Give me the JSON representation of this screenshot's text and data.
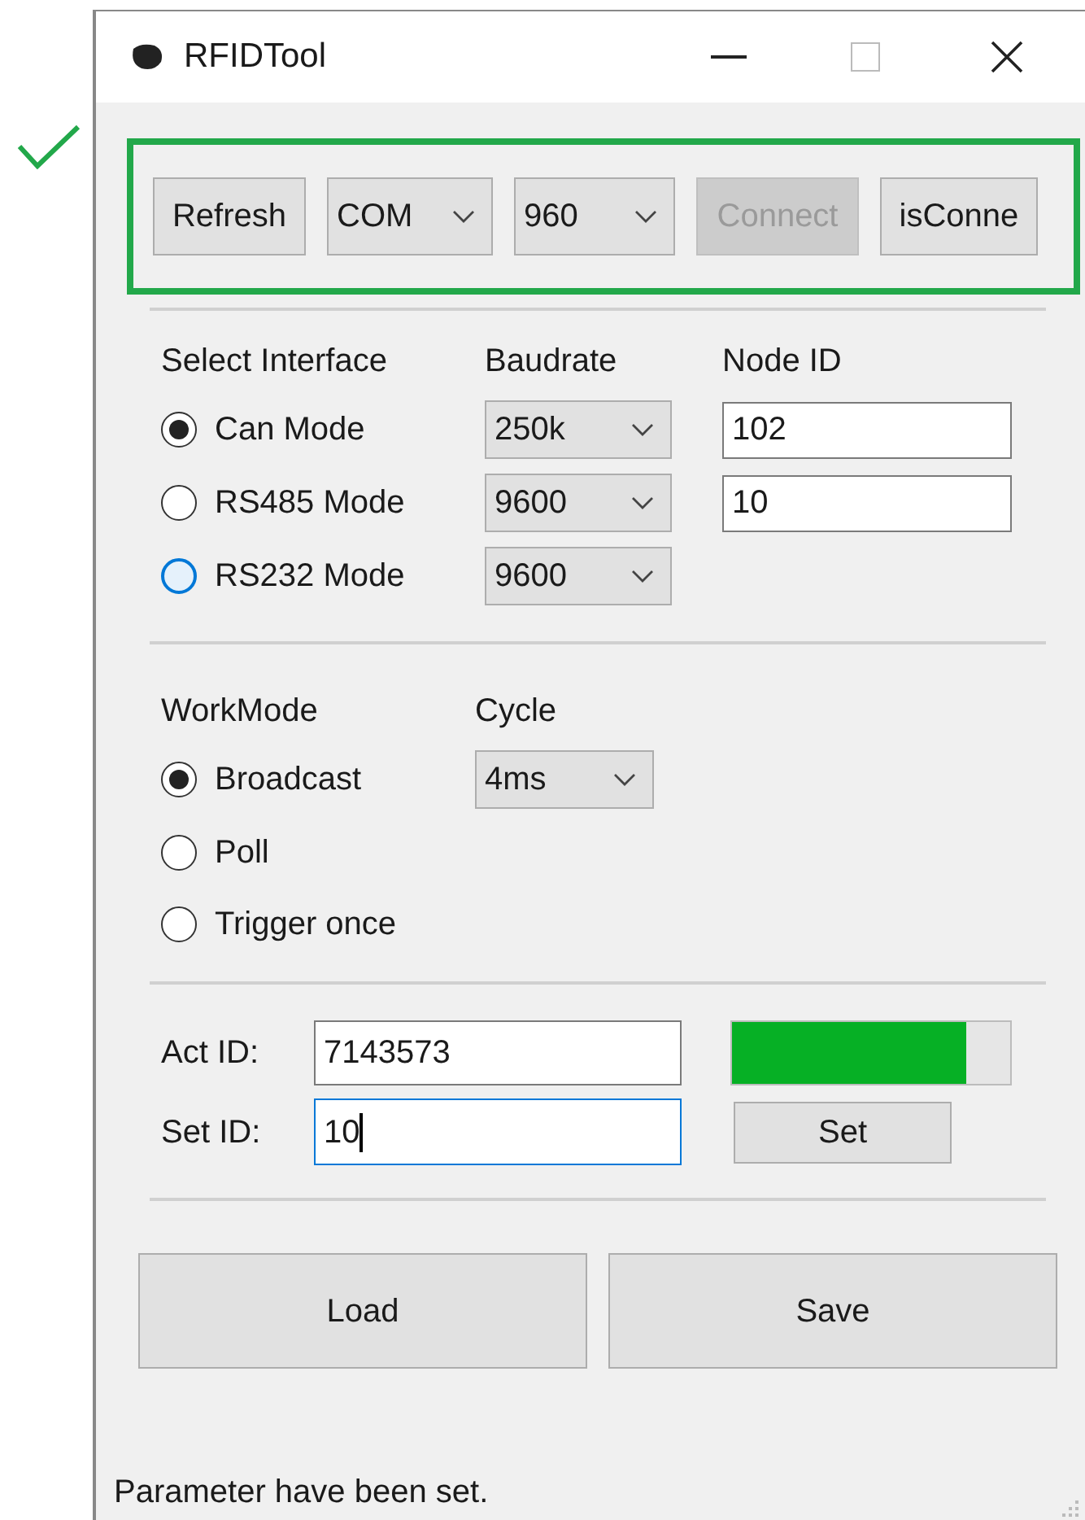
{
  "window": {
    "title": "RFIDTool"
  },
  "toolbar": {
    "items": [
      {
        "kind": "button",
        "label": "Refresh",
        "disabled": false
      },
      {
        "kind": "combo",
        "label": "COM"
      },
      {
        "kind": "combo",
        "label": "960"
      },
      {
        "kind": "button",
        "label": "Connect",
        "disabled": true
      },
      {
        "kind": "button",
        "label": "isConne",
        "disabled": false
      }
    ]
  },
  "interface": {
    "heading": "Select Interface",
    "baud_heading": "Baudrate",
    "node_heading": "Node ID",
    "rows": [
      {
        "label": "Can Mode",
        "selected": true,
        "focused": false,
        "baudrate": "250k",
        "node_id": "102"
      },
      {
        "label": "RS485 Mode",
        "selected": false,
        "focused": false,
        "baudrate": "9600",
        "node_id": "10"
      },
      {
        "label": "RS232 Mode",
        "selected": false,
        "focused": true,
        "baudrate": "9600"
      }
    ]
  },
  "work": {
    "heading": "WorkMode",
    "cycle_heading": "Cycle",
    "cycle": "4ms",
    "modes": [
      {
        "label": "Broadcast",
        "selected": true
      },
      {
        "label": "Poll",
        "selected": false
      },
      {
        "label": "Trigger once",
        "selected": false
      }
    ]
  },
  "ids": {
    "act_label": "Act ID:",
    "act_value": "7143573",
    "set_label": "Set ID:",
    "set_value": "10",
    "set_focused": true,
    "progress": {
      "level": 0.84
    },
    "set_button": "Set"
  },
  "actions": [
    "Load",
    "Save"
  ],
  "status_bar": "Parameter have been set."
}
